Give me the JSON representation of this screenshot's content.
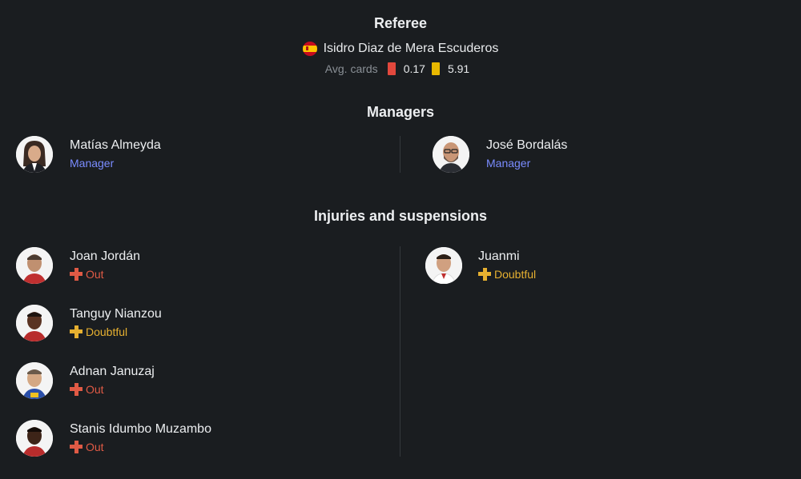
{
  "referee": {
    "title": "Referee",
    "name": "Isidro Diaz de Mera Escuderos",
    "flag_icon": "spain-flag-icon",
    "avg_cards_label": "Avg. cards",
    "red_avg": "0.17",
    "yellow_avg": "5.91",
    "red_color": "#e2483d",
    "yellow_color": "#e8b800"
  },
  "managers": {
    "title": "Managers",
    "home": {
      "name": "Matías Almeyda",
      "role": "Manager"
    },
    "away": {
      "name": "José Bordalás",
      "role": "Manager"
    }
  },
  "injuries": {
    "title": "Injuries and suspensions",
    "home": [
      {
        "name": "Joan Jordán",
        "status": "Out"
      },
      {
        "name": "Tanguy Nianzou",
        "status": "Doubtful"
      },
      {
        "name": "Adnan Januzaj",
        "status": "Out"
      },
      {
        "name": "Stanis Idumbo Muzambo",
        "status": "Out"
      }
    ],
    "away": [
      {
        "name": "Juanmi",
        "status": "Doubtful"
      }
    ]
  },
  "colors": {
    "background": "#1a1d20",
    "role_accent": "#7a8cff",
    "out": "#e05a45",
    "doubtful": "#e6b030"
  }
}
